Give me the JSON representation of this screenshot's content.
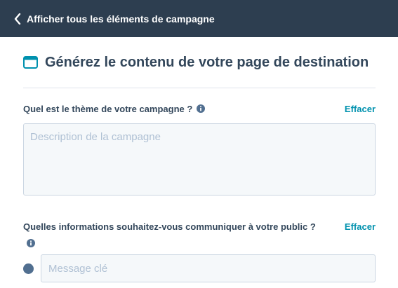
{
  "header": {
    "back_label": "Afficher tous les éléments de campagne",
    "back_icon": "chevron-left-icon"
  },
  "main": {
    "title_icon": "browser-window-icon",
    "title": "Générez le contenu de votre page de destination",
    "theme_question": {
      "label": "Quel est le thème de votre campagne ?",
      "info_icon": "info-icon",
      "clear_label": "Effacer",
      "placeholder": "Description de la campagne",
      "value": ""
    },
    "message_question": {
      "label": "Quelles informations souhaitez-vous communiquer à votre public ?",
      "info_icon": "info-icon",
      "clear_label": "Effacer",
      "placeholder": "Message clé",
      "value": ""
    }
  },
  "colors": {
    "header_bg": "#2d3e50",
    "text": "#33475b",
    "link": "#0091ae",
    "icon_accent": "#0091ae",
    "field_bg": "#f5f8fa",
    "field_border": "#cbd6e2",
    "placeholder": "#b0c1d4",
    "bullet": "#516f90"
  }
}
